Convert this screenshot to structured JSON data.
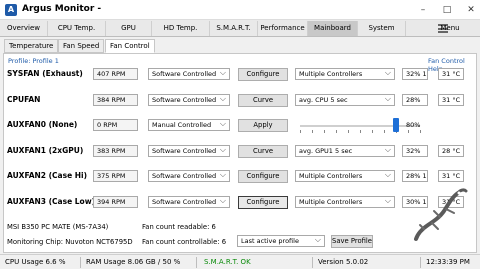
{
  "window": {
    "title": "Argus Monitor -",
    "minimize": "–",
    "maximize": "□",
    "close": "✕"
  },
  "nav_tabs": [
    "Overview",
    "CPU Temp.",
    "GPU",
    "HD Temp.",
    "S.M.A.R.T.",
    "Performance",
    "Mainboard",
    "System",
    "Menu"
  ],
  "sub_tabs": [
    "Temperature",
    "Fan Speed",
    "Fan Control"
  ],
  "profile_label": "Profile: Profile 1",
  "fan_control_help": "Fan Control Help",
  "fans": [
    {
      "name": "SYSFAN (Exhaust)",
      "rpm": "407 RPM",
      "mode": "Software Controlled",
      "button": "Configure",
      "source": "Multiple Controllers",
      "percent": "32% 1",
      "temp": "31 °C"
    },
    {
      "name": "CPUFAN",
      "rpm": "384 RPM",
      "mode": "Software Controlled",
      "button": "Curve",
      "source": "avg. CPU 5 sec",
      "percent": "28%",
      "temp": "31 °C"
    },
    {
      "name": "AUXFAN0 (None)",
      "rpm": "0 RPM",
      "mode": "Manual Controlled",
      "button": "Apply",
      "source": "",
      "percent": "80%",
      "temp": ""
    },
    {
      "name": "AUXFAN1 (2xGPU)",
      "rpm": "383 RPM",
      "mode": "Software Controlled",
      "button": "Curve",
      "source": "avg. GPU1 5 sec",
      "percent": "32%",
      "temp": "28 °C"
    },
    {
      "name": "AUXFAN2 (Case Hi)",
      "rpm": "375 RPM",
      "mode": "Software Controlled",
      "button": "Configure",
      "source": "Multiple Controllers",
      "percent": "28% 1",
      "temp": "31 °C"
    },
    {
      "name": "AUXFAN3 (Case Low)",
      "rpm": "394 RPM",
      "mode": "Software Controlled",
      "button": "Configure",
      "source": "Multiple Controllers",
      "percent": "30% 1",
      "temp": "31 °C"
    }
  ],
  "manual_slider": {
    "value_percent": 80
  },
  "board_info": "MSI B350 PC MATE (MS-7A34)",
  "chip_info": "Monitoring Chip: Nuvoton NCT6795D",
  "fan_readable": "Fan count readable: 6",
  "fan_controllable": "Fan count controllable: 6",
  "profile_select": "Last active profile",
  "save_profile": "Save Profile",
  "status": {
    "cpu": "CPU Usage 6.6 %",
    "ram": "RAM Usage 8.06 GB / 50 %",
    "smart": "S.M.A.R.T. OK",
    "version": "Version 5.0.02",
    "time": "12:33:39 PM"
  },
  "colors": {
    "accent": "#1e5aa8",
    "slider": "#1e6fd6",
    "smart_ok": "#0a8a0a"
  }
}
